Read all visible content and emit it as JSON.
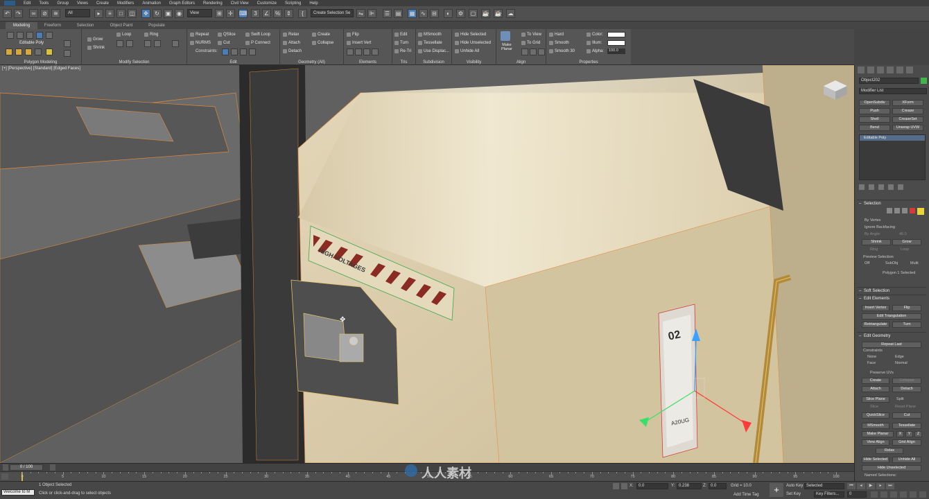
{
  "menu": [
    "Edit",
    "Tools",
    "Group",
    "Views",
    "Create",
    "Modifiers",
    "Animation",
    "Graph Editors",
    "Rendering",
    "Civil View",
    "Customize",
    "Scripting",
    "Help"
  ],
  "toolbar": {
    "filter_value": "All",
    "refcoord_value": "View",
    "selection_set_value": "Create Selection Se"
  },
  "ribbon_tabs": [
    "Modeling",
    "Freeform",
    "Selection",
    "Object Paint",
    "Populate"
  ],
  "ribbon": {
    "polygon_modeling": {
      "object_type": "Editable Poly",
      "label": "Polygon Modeling"
    },
    "modify_selection": {
      "grow": "Grow",
      "shrink": "Shrink",
      "loop": "Loop",
      "ring": "Ring",
      "label": "Modify Selection"
    },
    "edit": {
      "repeat": "Repeat",
      "qslice": "QSlice",
      "swift_loop": "Swift Loop",
      "nurms": "NURMS",
      "cut": "Cut",
      "p_connect": "P Connect",
      "constraints": "Constraints:",
      "label": "Edit"
    },
    "geometry": {
      "relax": "Relax",
      "create": "Create",
      "attach": "Attach",
      "collapse": "Collapse",
      "detach": "Detach",
      "label": "Geometry (All)"
    },
    "elements": {
      "flip": "Flip",
      "insert_vert": "Insert Vert",
      "label": "Elements"
    },
    "tris": {
      "edit": "Edit",
      "turn": "Turn",
      "retri": "Re-Tri",
      "label": "Tris"
    },
    "subdivision": {
      "msmooth": "MSmooth",
      "tessellate": "Tessellate",
      "use_displac": "Use Displac...",
      "label": "Subdivision"
    },
    "visibility": {
      "hide_selected": "Hide Selected",
      "hide_unselected": "Hide Unselected",
      "unhide_all": "Unhide All",
      "label": "Visibility"
    },
    "align": {
      "make_planar": "Make Planar",
      "to_view": "To View",
      "to_grid": "To Grid",
      "label": "Align"
    },
    "properties": {
      "hard": "Hard",
      "smooth": "Smooth",
      "smooth30": "Smooth 30",
      "color": "Color:",
      "illum": "Illum:",
      "alpha": "Alpha:",
      "alpha_value": "100.0",
      "label": "Properties"
    }
  },
  "viewport": {
    "label": "[+] [Perspective] [Standard] [Edged Faces]",
    "decal_text": "HIGH VOLTAGES",
    "panel_code": "A20UG",
    "panel_number": "02"
  },
  "command_panel": {
    "object_name": "Object202",
    "modifier_list": "Modifier List",
    "modifier_buttons": [
      "OpenSubdiv",
      "XForm",
      "Push",
      "Crease",
      "Shell",
      "CreaseSet",
      "Bend",
      "Unwrap UVW"
    ],
    "stack_item": "Editable Poly",
    "selection": {
      "title": "Selection",
      "by_vertex": "By Vertex",
      "ignore_backfacing": "Ignore Backfacing",
      "by_angle": "By Angle:",
      "by_angle_value": "45.0",
      "shrink": "Shrink",
      "grow": "Grow",
      "ring": "Ring",
      "loop": "Loop",
      "preview_selection": "Preview Selection",
      "off": "Off",
      "subobj": "SubObj",
      "multi": "Multi",
      "status": "Polygon 1 Selected"
    },
    "soft_selection": "Soft Selection",
    "edit_elements": {
      "title": "Edit Elements",
      "insert_vertex": "Insert Vertex",
      "flip": "Flip",
      "edit_triangulation": "Edit Triangulation",
      "retriangulate": "Retriangulate",
      "turn": "Turn"
    },
    "edit_geometry": {
      "title": "Edit Geometry",
      "repeat_last": "Repeat Last",
      "constraints": "Constraints",
      "none": "None",
      "edge": "Edge",
      "face": "Face",
      "normal": "Normal",
      "preserve_uvs": "Preserve UVs",
      "create": "Create",
      "collapse": "Collapse",
      "attach": "Attach",
      "detach": "Detach",
      "slice_plane": "Slice Plane",
      "split": "Split",
      "slice": "Slice",
      "reset_plane": "Reset Plane",
      "quickslice": "QuickSlice",
      "cut": "Cut",
      "msmooth": "MSmooth",
      "tessellate": "Tessellate",
      "make_planar": "Make Planar",
      "x": "X",
      "y": "Y",
      "z": "Z",
      "view_align": "View Align",
      "grid_align": "Grid Align",
      "relax": "Relax",
      "hide_selected": "Hide Selected",
      "unhide_all": "Unhide All",
      "hide_unselected": "Hide Unselected",
      "named_selections": "Named Selections:"
    }
  },
  "timeline": {
    "frame_display": "0 / 100",
    "ticks": [
      "0",
      "5",
      "10",
      "15",
      "20",
      "25",
      "30",
      "35",
      "40",
      "45",
      "50",
      "55",
      "60",
      "65",
      "70",
      "75",
      "80",
      "85",
      "90",
      "95",
      "100"
    ]
  },
  "status": {
    "maxscript": "Welcome to M",
    "objects_selected": "1 Object Selected",
    "prompt": "Click or click-and-drag to select objects",
    "x_label": "X:",
    "x_value": "0.0",
    "y_label": "Y:",
    "y_value": "0.238",
    "z_label": "Z:",
    "z_value": "0.0",
    "grid": "Grid = 10.0",
    "add_time_tag": "Add Time Tag",
    "auto_key": "Auto Key",
    "selected_dropdown": "Selected",
    "set_key": "Set Key",
    "key_filters": "Key Filters...",
    "current_frame": "0"
  },
  "watermark": "人人素材"
}
